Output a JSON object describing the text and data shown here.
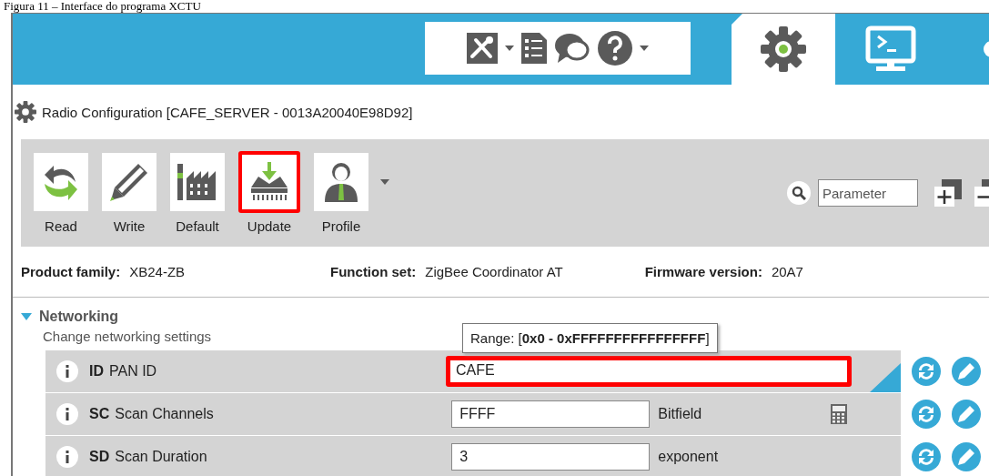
{
  "caption": "Figura 11 – Interface do programa XCTU",
  "header": {
    "tools": [
      {
        "kind": "tools",
        "dropdown": true
      },
      {
        "kind": "list",
        "dropdown": false
      },
      {
        "kind": "chat",
        "dropdown": false
      },
      {
        "kind": "help",
        "dropdown": true
      }
    ],
    "tabs": [
      {
        "kind": "configuration",
        "selected": true
      },
      {
        "kind": "console",
        "selected": false
      },
      {
        "kind": "network",
        "selected": false
      }
    ]
  },
  "panel_title": "Radio Configuration [CAFE_SERVER - 0013A20040E98D92]",
  "toolbar": {
    "buttons": [
      {
        "kind": "read",
        "label": "Read",
        "highlighted": false
      },
      {
        "kind": "write",
        "label": "Write",
        "highlighted": false
      },
      {
        "kind": "default",
        "label": "Default",
        "highlighted": false
      },
      {
        "kind": "update",
        "label": "Update",
        "highlighted": true
      },
      {
        "kind": "profile",
        "label": "Profile",
        "highlighted": false
      }
    ],
    "search": {
      "placeholder": "Parameter"
    }
  },
  "info": [
    {
      "label": "Product family:",
      "value": "XB24-ZB"
    },
    {
      "label": "Function set:",
      "value": "ZigBee Coordinator AT"
    },
    {
      "label": "Firmware version:",
      "value": "20A7"
    }
  ],
  "section": {
    "title": "Networking",
    "subtitle": "Change networking settings",
    "expanded": true
  },
  "tooltip": "Range: [**0x0 - 0xFFFFFFFFFFFFFFFF**]",
  "rows": [
    {
      "kind": "text",
      "code": "ID",
      "name": "PAN ID",
      "value": "CAFE",
      "highlighted": true,
      "modified": true
    },
    {
      "kind": "bitfield",
      "code": "SC",
      "name": "Scan Channels",
      "value": "FFFF",
      "unit": "Bitfield",
      "highlighted": false,
      "modified": false
    },
    {
      "kind": "number",
      "code": "SD",
      "name": "Scan Duration",
      "value": "3",
      "unit": "exponent",
      "highlighted": false,
      "modified": false
    }
  ]
}
